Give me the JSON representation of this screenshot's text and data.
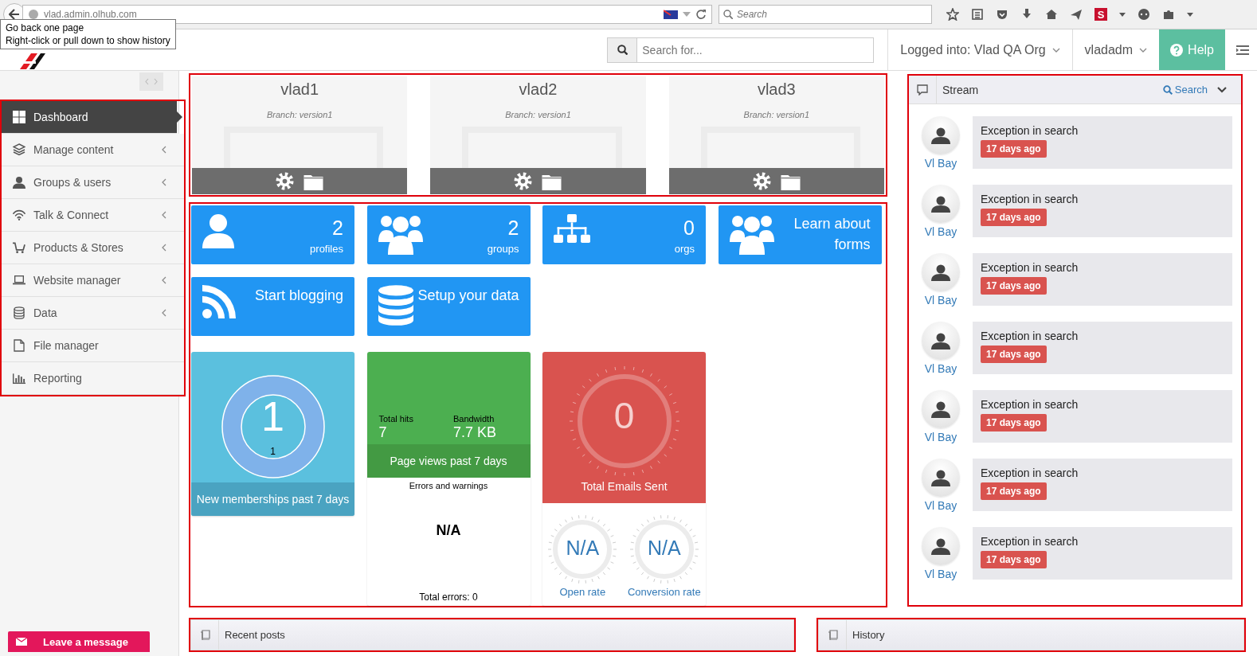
{
  "browser": {
    "url": "vlad.admin.olhub.com",
    "search_placeholder": "Search",
    "addon_label": "S",
    "tooltip": [
      "Go back one page",
      "Right-click or pull down to show history"
    ]
  },
  "header": {
    "search_placeholder": "Search for...",
    "org": "Logged into: Vlad QA Org",
    "user": "vladadm",
    "help": "Help"
  },
  "sidebar": {
    "highlighted": true,
    "items": [
      {
        "label": "Dashboard",
        "selected": true,
        "has_submenu": false
      },
      {
        "label": "Manage content",
        "selected": false,
        "has_submenu": true
      },
      {
        "label": "Groups & users",
        "selected": false,
        "has_submenu": true
      },
      {
        "label": "Talk & Connect",
        "selected": false,
        "has_submenu": true
      },
      {
        "label": "Products & Stores",
        "selected": false,
        "has_submenu": true
      },
      {
        "label": "Website manager",
        "selected": false,
        "has_submenu": true
      },
      {
        "label": "Data",
        "selected": false,
        "has_submenu": true
      },
      {
        "label": "File manager",
        "selected": false,
        "has_submenu": false
      },
      {
        "label": "Reporting",
        "selected": false,
        "has_submenu": false
      }
    ],
    "leave_message": "Leave a message"
  },
  "sites": {
    "highlighted": true,
    "items": [
      {
        "name": "vlad1",
        "branch": "Branch: version1"
      },
      {
        "name": "vlad2",
        "branch": "Branch: version1"
      },
      {
        "name": "vlad3",
        "branch": "Branch: version1"
      }
    ]
  },
  "dashboard": {
    "highlighted": true,
    "tiles": [
      {
        "kind": "stat",
        "value": "2",
        "label": "profiles"
      },
      {
        "kind": "stat",
        "value": "2",
        "label": "groups"
      },
      {
        "kind": "stat",
        "value": "0",
        "label": "orgs"
      },
      {
        "kind": "action",
        "text": "Learn about forms"
      },
      {
        "kind": "action",
        "text": "Start blogging"
      },
      {
        "kind": "action",
        "text": "Setup your data"
      }
    ],
    "memberships": {
      "value": "1",
      "sub_value": "1",
      "caption": "New memberships past 7 days"
    },
    "page_views": {
      "hits_label": "Total hits",
      "hits": "7",
      "bandwidth_label": "Bandwidth",
      "bandwidth": "7.7 KB",
      "caption": "Page views past 7 days",
      "errors_title": "Errors and warnings",
      "errors_value": "N/A",
      "errors_total": "Total errors: 0"
    },
    "emails": {
      "value": "0",
      "caption": "Total Emails Sent",
      "rates": [
        {
          "value": "N/A",
          "label": "Open rate"
        },
        {
          "value": "N/A",
          "label": "Conversion rate"
        }
      ]
    }
  },
  "stream": {
    "highlighted": true,
    "title": "Stream",
    "search": "Search",
    "items": [
      {
        "user": "Vl Bay",
        "text": "Exception in search",
        "time": "17 days ago"
      },
      {
        "user": "Vl Bay",
        "text": "Exception in search",
        "time": "17 days ago"
      },
      {
        "user": "Vl Bay",
        "text": "Exception in search",
        "time": "17 days ago"
      },
      {
        "user": "Vl Bay",
        "text": "Exception in search",
        "time": "17 days ago"
      },
      {
        "user": "Vl Bay",
        "text": "Exception in search",
        "time": "17 days ago"
      },
      {
        "user": "Vl Bay",
        "text": "Exception in search",
        "time": "17 days ago"
      },
      {
        "user": "Vl Bay",
        "text": "Exception in search",
        "time": "17 days ago"
      }
    ]
  },
  "panels": [
    {
      "title": "Recent posts",
      "highlighted": true
    },
    {
      "title": "History",
      "highlighted": true
    }
  ]
}
